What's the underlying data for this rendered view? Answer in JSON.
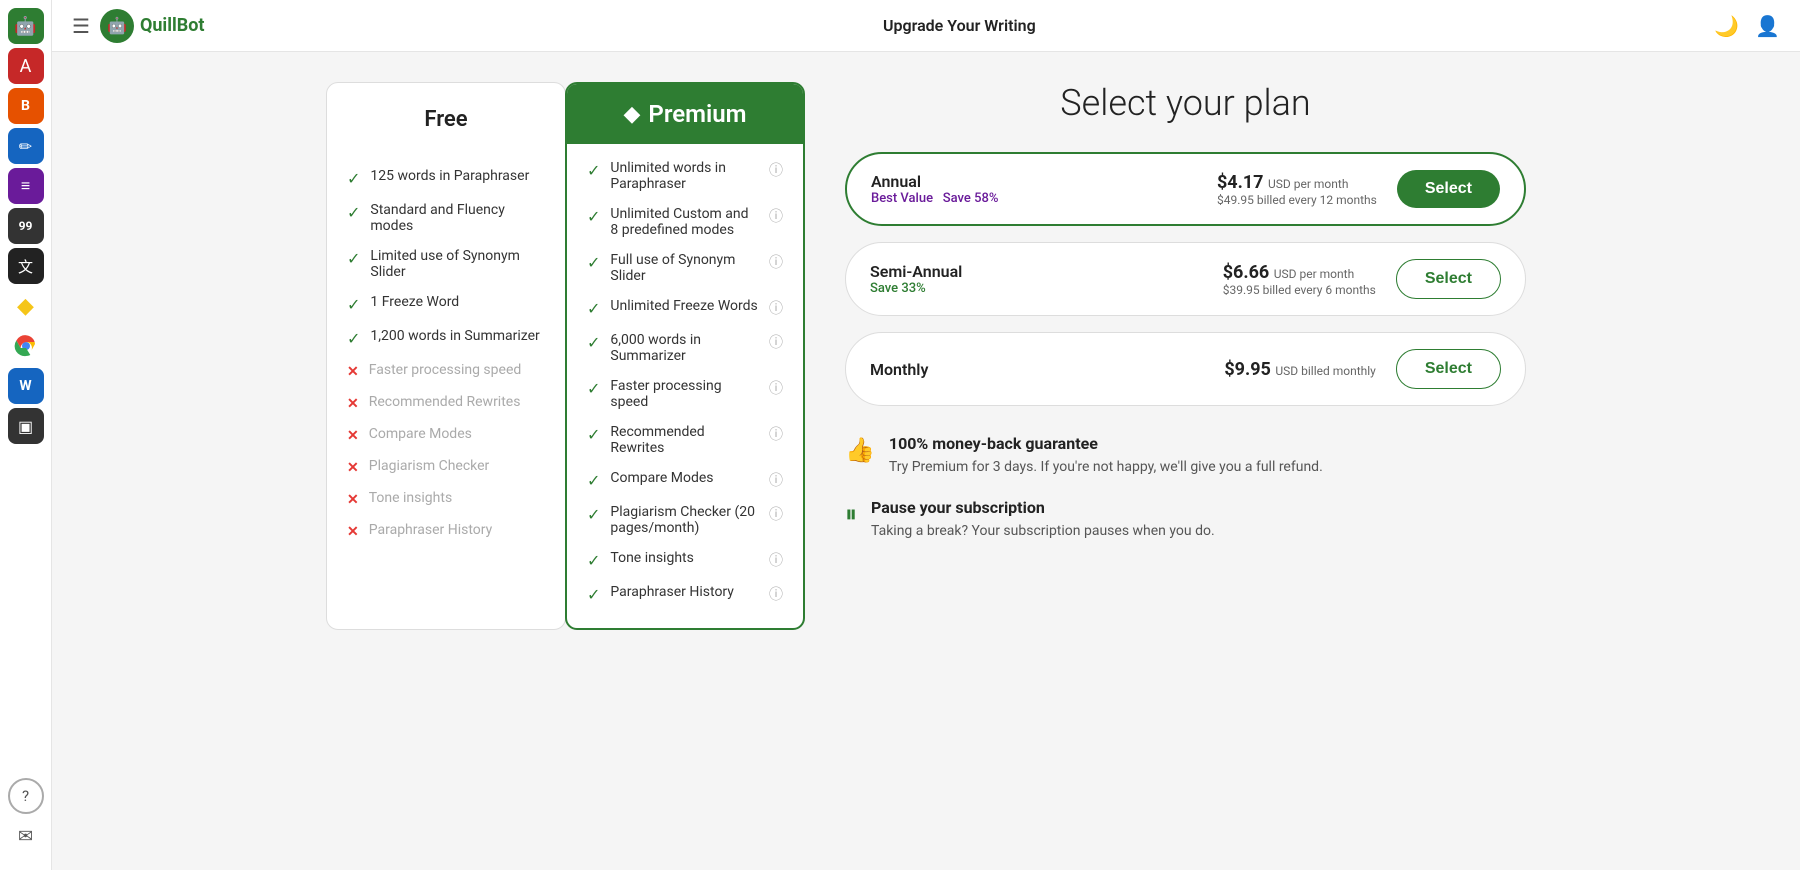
{
  "header": {
    "hamburger": "☰",
    "logo_text": "QuillBot",
    "title": "Upgrade Your Writing",
    "dark_mode_icon": "🌙",
    "user_icon": "👤"
  },
  "sidebar": {
    "icons": [
      {
        "name": "menu-icon",
        "symbol": "☰",
        "class": ""
      },
      {
        "name": "quillbot-icon",
        "symbol": "Q",
        "class": "green"
      },
      {
        "name": "grammar-icon",
        "symbol": "A",
        "class": "red"
      },
      {
        "name": "summarizer-icon",
        "symbol": "B",
        "class": "orange"
      },
      {
        "name": "paraphraser-icon",
        "symbol": "P",
        "class": "blue"
      },
      {
        "name": "fluency-icon",
        "symbol": "≡",
        "class": "purple"
      },
      {
        "name": "plagiarism-icon",
        "symbol": "99",
        "class": "gray-num"
      },
      {
        "name": "translator-icon",
        "symbol": "X",
        "class": "black-x"
      },
      {
        "name": "premium-icon",
        "symbol": "◆",
        "class": "yellow-gem"
      },
      {
        "name": "chrome-icon",
        "symbol": "⊕",
        "class": ""
      },
      {
        "name": "word-icon",
        "symbol": "W",
        "class": "word"
      },
      {
        "name": "extension-icon",
        "symbol": "▣",
        "class": "monitor"
      }
    ],
    "bottom_icons": [
      {
        "name": "help-icon",
        "symbol": "?"
      },
      {
        "name": "mail-icon",
        "symbol": "✉"
      }
    ]
  },
  "free_plan": {
    "name": "Free",
    "features": [
      {
        "text": "125 words in Paraphraser",
        "enabled": true
      },
      {
        "text": "Standard and Fluency modes",
        "enabled": true
      },
      {
        "text": "Limited use of Synonym Slider",
        "enabled": true
      },
      {
        "text": "1 Freeze Word",
        "enabled": true
      },
      {
        "text": "1,200 words in Summarizer",
        "enabled": true
      },
      {
        "text": "Faster processing speed",
        "enabled": false
      },
      {
        "text": "Recommended Rewrites",
        "enabled": false
      },
      {
        "text": "Compare Modes",
        "enabled": false
      },
      {
        "text": "Plagiarism Checker",
        "enabled": false
      },
      {
        "text": "Tone insights",
        "enabled": false
      },
      {
        "text": "Paraphraser History",
        "enabled": false
      }
    ]
  },
  "premium_plan": {
    "name": "Premium",
    "gem_icon": "◆",
    "features": [
      {
        "text": "Unlimited words in Paraphraser",
        "info": true
      },
      {
        "text": "Unlimited Custom and 8 predefined modes",
        "info": true
      },
      {
        "text": "Full use of Synonym Slider",
        "info": true
      },
      {
        "text": "Unlimited Freeze Words",
        "info": true
      },
      {
        "text": "6,000 words in Summarizer",
        "info": true
      },
      {
        "text": "Faster processing speed",
        "info": true
      },
      {
        "text": "Recommended Rewrites",
        "info": true
      },
      {
        "text": "Compare Modes",
        "info": true
      },
      {
        "text": "Plagiarism Checker (20 pages/month)",
        "info": true
      },
      {
        "text": "Tone insights",
        "info": true
      },
      {
        "text": "Paraphraser History",
        "info": true
      }
    ]
  },
  "plan_selection": {
    "title": "Select your plan",
    "plans": [
      {
        "name": "Annual",
        "save": "Save 58%",
        "main_price": "$4.17",
        "price_unit": "USD per month",
        "sub_price": "$49.95 billed every 12 months",
        "button_label": "Select",
        "is_annual": true,
        "is_primary": true
      },
      {
        "name": "Semi-Annual",
        "save": "Save 33%",
        "main_price": "$6.66",
        "price_unit": "USD per month",
        "sub_price": "$39.95 billed every 6 months",
        "button_label": "Select",
        "is_annual": false,
        "is_primary": false
      },
      {
        "name": "Monthly",
        "save": "",
        "main_price": "$9.95",
        "price_unit": "USD billed monthly",
        "sub_price": "",
        "button_label": "Select",
        "is_annual": false,
        "is_primary": false
      }
    ],
    "guarantees": [
      {
        "icon": "👍",
        "title": "100% money-back guarantee",
        "description": "Try Premium for 3 days. If you're not happy, we'll give you a full refund."
      },
      {
        "icon": "⏸",
        "title": "Pause your subscription",
        "description": "Taking a break? Your subscription pauses when you do."
      }
    ]
  }
}
